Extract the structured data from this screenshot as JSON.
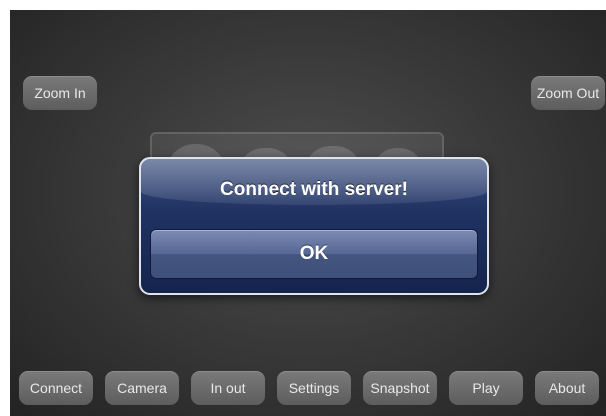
{
  "top_buttons": {
    "zoom_in": "Zoom In",
    "zoom_out": "Zoom Out"
  },
  "alert": {
    "title": "Connect with server!",
    "ok_label": "OK"
  },
  "bottom_toolbar": [
    {
      "label": "Connect"
    },
    {
      "label": "Camera"
    },
    {
      "label": "In out"
    },
    {
      "label": "Settings"
    },
    {
      "label": "Snapshot"
    },
    {
      "label": "Play"
    },
    {
      "label": "About"
    }
  ],
  "colors": {
    "alert_background": "#1f3262",
    "alert_border": "#dfe3ea",
    "button_gray": "#6b6b6b",
    "screen_background": "#3a3a3a"
  }
}
